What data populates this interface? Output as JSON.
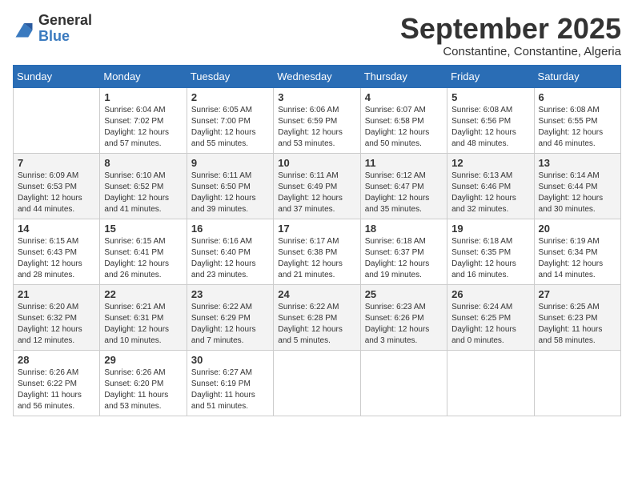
{
  "logo": {
    "general": "General",
    "blue": "Blue"
  },
  "title": "September 2025",
  "subtitle": "Constantine, Constantine, Algeria",
  "days": [
    "Sunday",
    "Monday",
    "Tuesday",
    "Wednesday",
    "Thursday",
    "Friday",
    "Saturday"
  ],
  "weeks": [
    [
      {
        "day": "",
        "content": ""
      },
      {
        "day": "1",
        "content": "Sunrise: 6:04 AM\nSunset: 7:02 PM\nDaylight: 12 hours\nand 57 minutes."
      },
      {
        "day": "2",
        "content": "Sunrise: 6:05 AM\nSunset: 7:00 PM\nDaylight: 12 hours\nand 55 minutes."
      },
      {
        "day": "3",
        "content": "Sunrise: 6:06 AM\nSunset: 6:59 PM\nDaylight: 12 hours\nand 53 minutes."
      },
      {
        "day": "4",
        "content": "Sunrise: 6:07 AM\nSunset: 6:58 PM\nDaylight: 12 hours\nand 50 minutes."
      },
      {
        "day": "5",
        "content": "Sunrise: 6:08 AM\nSunset: 6:56 PM\nDaylight: 12 hours\nand 48 minutes."
      },
      {
        "day": "6",
        "content": "Sunrise: 6:08 AM\nSunset: 6:55 PM\nDaylight: 12 hours\nand 46 minutes."
      }
    ],
    [
      {
        "day": "7",
        "content": "Sunrise: 6:09 AM\nSunset: 6:53 PM\nDaylight: 12 hours\nand 44 minutes."
      },
      {
        "day": "8",
        "content": "Sunrise: 6:10 AM\nSunset: 6:52 PM\nDaylight: 12 hours\nand 41 minutes."
      },
      {
        "day": "9",
        "content": "Sunrise: 6:11 AM\nSunset: 6:50 PM\nDaylight: 12 hours\nand 39 minutes."
      },
      {
        "day": "10",
        "content": "Sunrise: 6:11 AM\nSunset: 6:49 PM\nDaylight: 12 hours\nand 37 minutes."
      },
      {
        "day": "11",
        "content": "Sunrise: 6:12 AM\nSunset: 6:47 PM\nDaylight: 12 hours\nand 35 minutes."
      },
      {
        "day": "12",
        "content": "Sunrise: 6:13 AM\nSunset: 6:46 PM\nDaylight: 12 hours\nand 32 minutes."
      },
      {
        "day": "13",
        "content": "Sunrise: 6:14 AM\nSunset: 6:44 PM\nDaylight: 12 hours\nand 30 minutes."
      }
    ],
    [
      {
        "day": "14",
        "content": "Sunrise: 6:15 AM\nSunset: 6:43 PM\nDaylight: 12 hours\nand 28 minutes."
      },
      {
        "day": "15",
        "content": "Sunrise: 6:15 AM\nSunset: 6:41 PM\nDaylight: 12 hours\nand 26 minutes."
      },
      {
        "day": "16",
        "content": "Sunrise: 6:16 AM\nSunset: 6:40 PM\nDaylight: 12 hours\nand 23 minutes."
      },
      {
        "day": "17",
        "content": "Sunrise: 6:17 AM\nSunset: 6:38 PM\nDaylight: 12 hours\nand 21 minutes."
      },
      {
        "day": "18",
        "content": "Sunrise: 6:18 AM\nSunset: 6:37 PM\nDaylight: 12 hours\nand 19 minutes."
      },
      {
        "day": "19",
        "content": "Sunrise: 6:18 AM\nSunset: 6:35 PM\nDaylight: 12 hours\nand 16 minutes."
      },
      {
        "day": "20",
        "content": "Sunrise: 6:19 AM\nSunset: 6:34 PM\nDaylight: 12 hours\nand 14 minutes."
      }
    ],
    [
      {
        "day": "21",
        "content": "Sunrise: 6:20 AM\nSunset: 6:32 PM\nDaylight: 12 hours\nand 12 minutes."
      },
      {
        "day": "22",
        "content": "Sunrise: 6:21 AM\nSunset: 6:31 PM\nDaylight: 12 hours\nand 10 minutes."
      },
      {
        "day": "23",
        "content": "Sunrise: 6:22 AM\nSunset: 6:29 PM\nDaylight: 12 hours\nand 7 minutes."
      },
      {
        "day": "24",
        "content": "Sunrise: 6:22 AM\nSunset: 6:28 PM\nDaylight: 12 hours\nand 5 minutes."
      },
      {
        "day": "25",
        "content": "Sunrise: 6:23 AM\nSunset: 6:26 PM\nDaylight: 12 hours\nand 3 minutes."
      },
      {
        "day": "26",
        "content": "Sunrise: 6:24 AM\nSunset: 6:25 PM\nDaylight: 12 hours\nand 0 minutes."
      },
      {
        "day": "27",
        "content": "Sunrise: 6:25 AM\nSunset: 6:23 PM\nDaylight: 11 hours\nand 58 minutes."
      }
    ],
    [
      {
        "day": "28",
        "content": "Sunrise: 6:26 AM\nSunset: 6:22 PM\nDaylight: 11 hours\nand 56 minutes."
      },
      {
        "day": "29",
        "content": "Sunrise: 6:26 AM\nSunset: 6:20 PM\nDaylight: 11 hours\nand 53 minutes."
      },
      {
        "day": "30",
        "content": "Sunrise: 6:27 AM\nSunset: 6:19 PM\nDaylight: 11 hours\nand 51 minutes."
      },
      {
        "day": "",
        "content": ""
      },
      {
        "day": "",
        "content": ""
      },
      {
        "day": "",
        "content": ""
      },
      {
        "day": "",
        "content": ""
      }
    ]
  ]
}
